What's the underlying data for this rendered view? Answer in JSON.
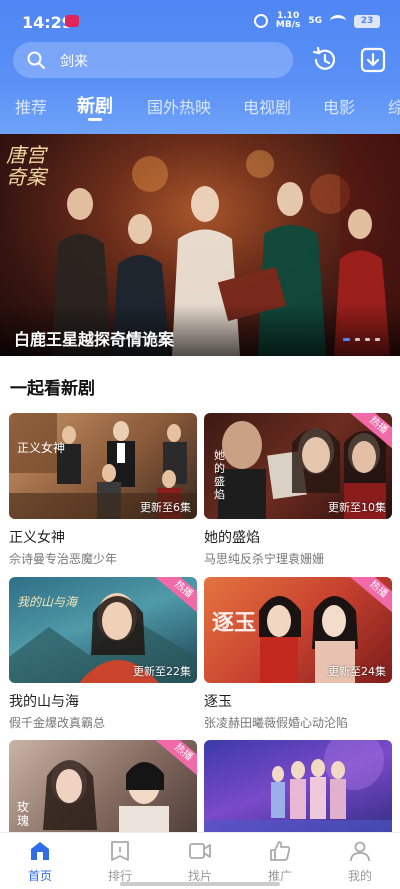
{
  "status_bar": {
    "time": "14:29",
    "speed_top": "1.10",
    "speed_unit": "MB/s",
    "network": "5G",
    "battery": "23"
  },
  "search": {
    "value": "剑来"
  },
  "tabs": [
    {
      "label": "推荐",
      "active": false
    },
    {
      "label": "新剧",
      "active": true
    },
    {
      "label": "国外热映",
      "active": false
    },
    {
      "label": "电视剧",
      "active": false
    },
    {
      "label": "电影",
      "active": false
    },
    {
      "label": "综",
      "active": false
    }
  ],
  "banner": {
    "title": "白鹿王星越探奇情诡案",
    "poster_text": "唐宫奇案",
    "active_dot": 1,
    "dot_count": 4
  },
  "section": {
    "title": "一起看新剧"
  },
  "cards": [
    {
      "title": "正义女神",
      "subtitle": "佘诗曼专治恶魔少年",
      "episodes": "更新至6集",
      "hot": false,
      "poster_text": "正义女神"
    },
    {
      "title": "她的盛焰",
      "subtitle": "马思纯反杀宁理袁姗姗",
      "episodes": "更新至10集",
      "hot": true,
      "hot_label": "热播",
      "poster_text": "她的盛焰"
    },
    {
      "title": "我的山与海",
      "subtitle": "假千金爆改真霸总",
      "episodes": "更新至22集",
      "hot": true,
      "hot_label": "热播",
      "poster_text": "我的山与海"
    },
    {
      "title": "逐玉",
      "subtitle": "张凌赫田曦薇假婚心动沦陷",
      "episodes": "更新至24集",
      "hot": true,
      "hot_label": "热播",
      "poster_text": "逐玉"
    },
    {
      "title": "",
      "subtitle": "",
      "episodes": "",
      "hot": true,
      "hot_label": "热播",
      "poster_text": "玫瑰"
    },
    {
      "title": "",
      "subtitle": "",
      "episodes": "",
      "hot": false,
      "poster_text": ""
    }
  ],
  "bottom_nav": [
    {
      "label": "首页",
      "icon": "home-icon",
      "active": true
    },
    {
      "label": "排行",
      "icon": "ranking-icon",
      "active": false
    },
    {
      "label": "找片",
      "icon": "video-camera-icon",
      "active": false
    },
    {
      "label": "推广",
      "icon": "thumbs-up-icon",
      "active": false
    },
    {
      "label": "我的",
      "icon": "user-icon",
      "active": false
    }
  ],
  "colors": {
    "header_blue": "#4f86f3",
    "active_nav": "#2f6de8",
    "hot_badge": "#f06aa8"
  }
}
